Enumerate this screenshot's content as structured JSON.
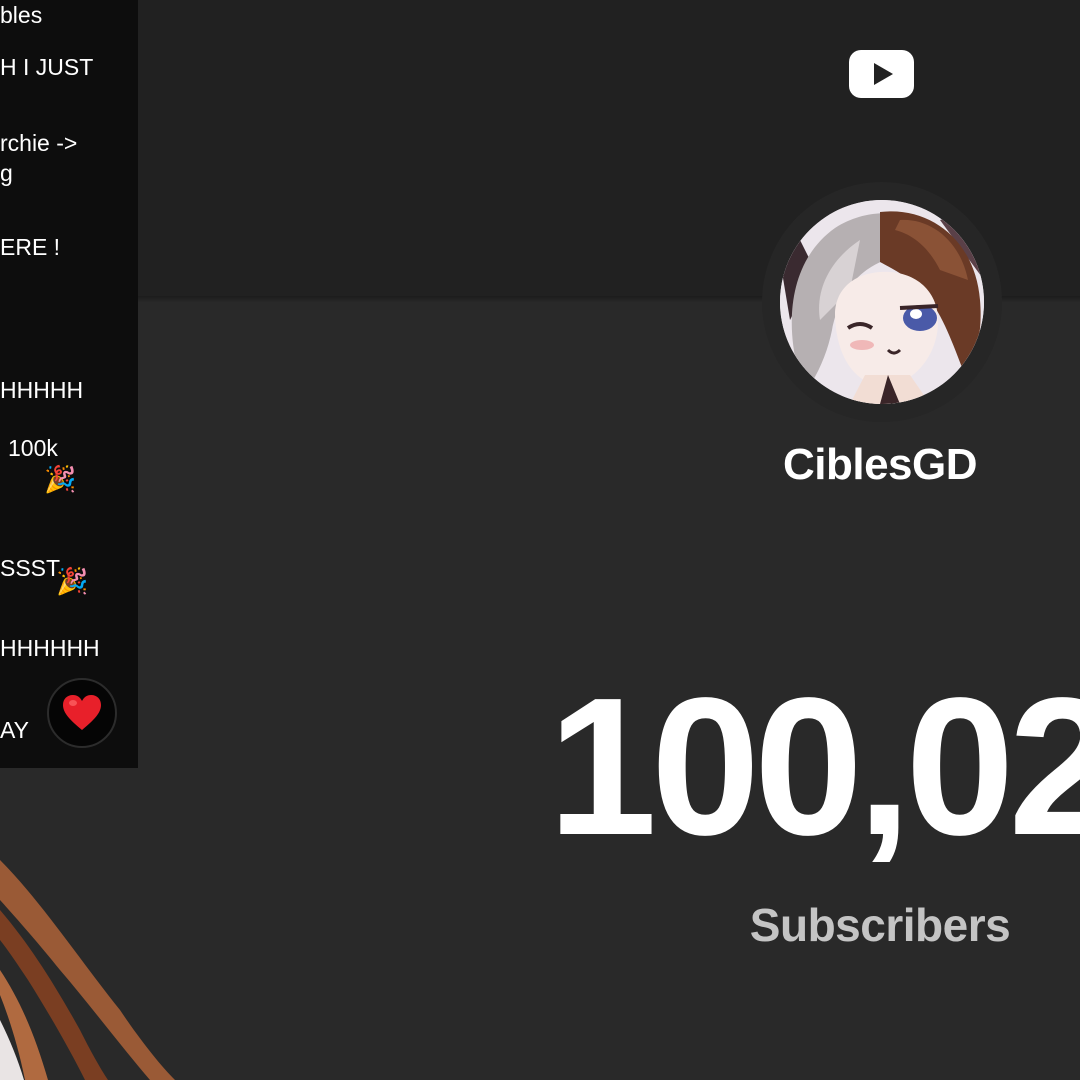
{
  "chat": {
    "lines": [
      "bles",
      "H I JUST",
      "rchie ->",
      "g",
      "ERE !",
      "HHHHH",
      "100k",
      "SSST",
      "HHHHHH",
      "AY"
    ]
  },
  "channel": {
    "name": "CiblesGD"
  },
  "counter": {
    "value": "100,02",
    "label": "Subscribers"
  },
  "icons": {
    "logo": "youtube-play-icon",
    "reaction": "heart-icon",
    "emoji": "party-popper-icon"
  },
  "colors": {
    "background": "#292929",
    "header": "#212121",
    "chat_background": "#0d0d0d",
    "text": "#ffffff",
    "label": "#c4c4c4",
    "heart": "#e8202a",
    "hair": "#9a5a36"
  }
}
